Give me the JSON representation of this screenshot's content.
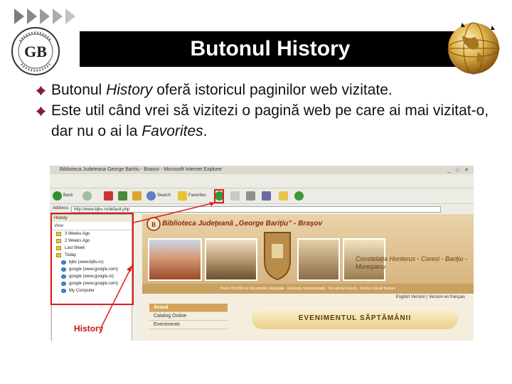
{
  "header": {
    "title": "Butonul History",
    "logo_text": "BIBLIOTECA JUDEŢEANĂ GB BRAŞOV"
  },
  "bullets": [
    {
      "parts": [
        {
          "text": "Butonul ",
          "italic": false
        },
        {
          "text": "History",
          "italic": true
        },
        {
          "text": " oferă istoricul paginilor web vizitate.",
          "italic": false
        }
      ]
    },
    {
      "parts": [
        {
          "text": "Este util când vrei să vizitezi o pagină web pe care ai mai vizitat-o, dar nu o ai la ",
          "italic": false
        },
        {
          "text": "Favorites",
          "italic": true
        },
        {
          "text": ".",
          "italic": false
        }
      ]
    }
  ],
  "browser": {
    "window_title": "Biblioteca Judeteana George Baritiu - Brasov - Microsoft Internet Explorer",
    "toolbar": {
      "back": "Back",
      "search": "Search",
      "favorites": "Favorites"
    },
    "address_label": "Address",
    "address_value": "http://www.bjbv.ro/default.php",
    "history_pane": {
      "header": "History",
      "view_bar": "View",
      "items": [
        {
          "label": "3 Weeks Ago",
          "sub": false
        },
        {
          "label": "2 Weeks Ago",
          "sub": false
        },
        {
          "label": "Last Week",
          "sub": false
        },
        {
          "label": "Today",
          "sub": false
        },
        {
          "label": "bjbv (www.bjbv.ro)",
          "sub": true
        },
        {
          "label": "google (www.google.com)",
          "sub": true
        },
        {
          "label": "google (www.google.ro)",
          "sub": true
        },
        {
          "label": "google (www.google.com)",
          "sub": true
        },
        {
          "label": "My Computer",
          "sub": true
        }
      ]
    },
    "page": {
      "site_title": "Biblioteca Judeţeană „George Bariţiu” - Braşov",
      "strip_text": "Peste 200.000 de documente catalogate · Evidenţă computerizată · Trei săli de lectură · Centru cultural francez",
      "motto": "Constelaţia Honterus - Coresi - Bariţiu - Mureşianu",
      "lang": "English Version | Version en français",
      "menu": [
        "Acasă",
        "Catalog Online",
        "Evenimente"
      ],
      "event_button": "EVENIMENTUL SĂPTĂMÂNII"
    },
    "history_callout": "History",
    "colors": {
      "callout": "#cc1111",
      "title_bar": "#000000",
      "bullet": "#8b1a3a"
    }
  }
}
